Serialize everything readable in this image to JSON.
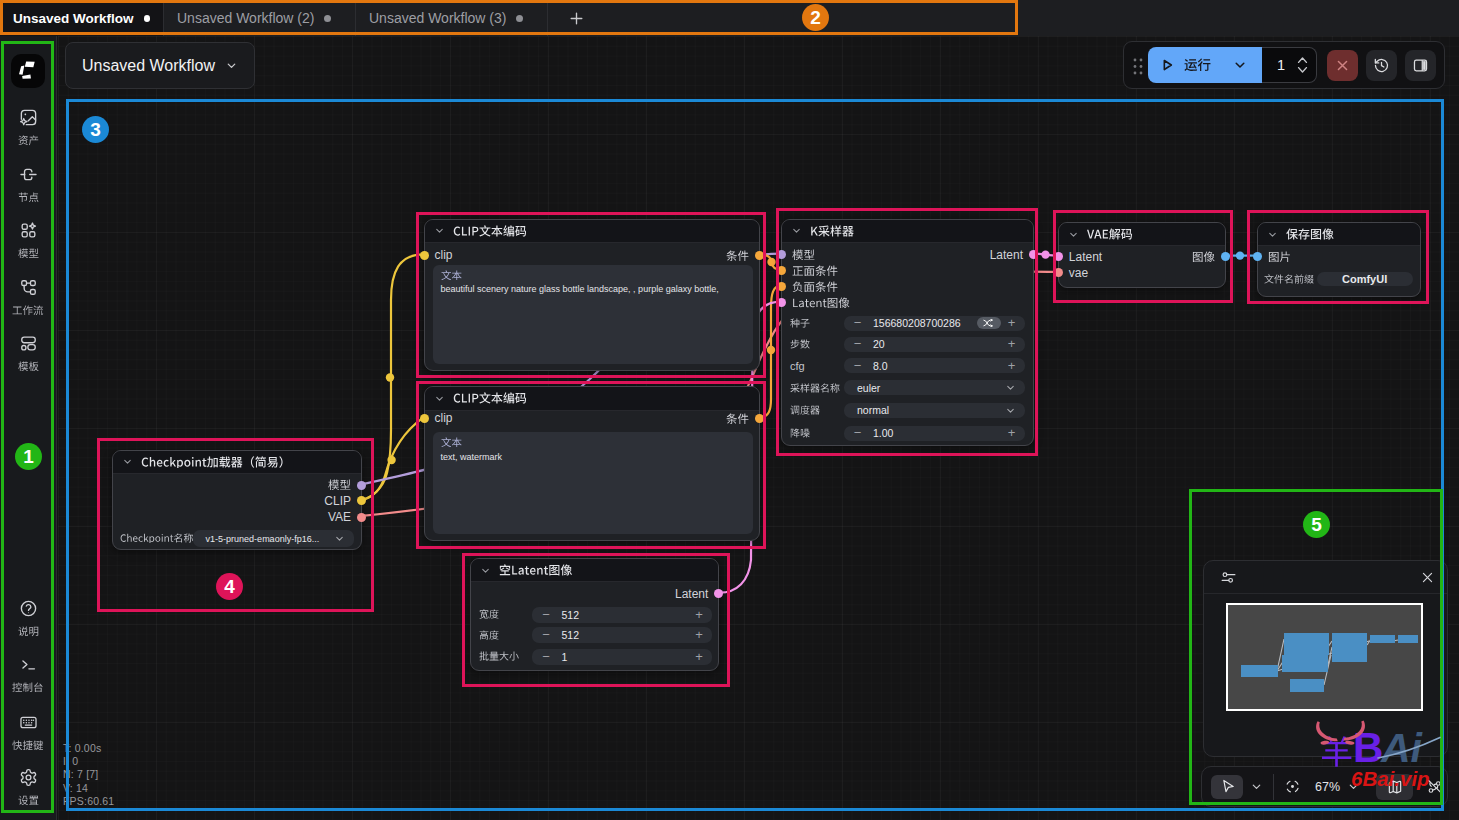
{
  "tabbar": {
    "tabs": [
      {
        "label": "Unsaved Workflow",
        "state": "active"
      },
      {
        "label": "Unsaved Workflow (2)",
        "state": "inactive"
      },
      {
        "label": "Unsaved Workflow (3)",
        "state": "inactive"
      }
    ]
  },
  "sidebar": {
    "top_items": [
      {
        "label": "资产",
        "icon": "assets-image-icon"
      },
      {
        "label": "节点",
        "icon": "nodes-icon"
      },
      {
        "label": "模型",
        "icon": "models-icon"
      },
      {
        "label": "工作流",
        "icon": "workflows-icon"
      },
      {
        "label": "模板",
        "icon": "templates-icon"
      }
    ],
    "bottom_items": [
      {
        "label": "说明",
        "icon": "help-icon"
      },
      {
        "label": "控制台",
        "icon": "terminal-icon"
      },
      {
        "label": "快捷键",
        "icon": "keyboard-icon"
      },
      {
        "label": "设置",
        "icon": "settings-gear-icon"
      }
    ]
  },
  "topbar": {
    "workflow_selector": {
      "label": "Unsaved Workflow"
    },
    "run_button": {
      "label": "运行"
    },
    "batch_count": "1"
  },
  "canvas_stats": {
    "lines": [
      "T: 0.00s",
      "I: 0",
      "N: 7 [7]",
      "V: 14",
      "FPS:60.61"
    ]
  },
  "nodes": {
    "checkpoint_loader": {
      "title": "Checkpoint加载器（简易）",
      "outputs": [
        "模型",
        "CLIP",
        "VAE"
      ],
      "widgets": {
        "ckpt_name": {
          "label": "Checkpoint名称",
          "value": "v1-5-pruned-emaonly-fp16..."
        }
      }
    },
    "clip_encode_positive": {
      "title": "CLIP文本编码",
      "inputs": [
        "clip"
      ],
      "outputs": [
        "条件"
      ],
      "widgets": {
        "text": {
          "label": "文本",
          "value": "beautiful scenery nature glass bottle landscape, , purple galaxy bottle,"
        }
      }
    },
    "clip_encode_negative": {
      "title": "CLIP文本编码",
      "inputs": [
        "clip"
      ],
      "outputs": [
        "条件"
      ],
      "widgets": {
        "text": {
          "label": "文本",
          "value": "text, watermark"
        }
      }
    },
    "ksampler": {
      "title": "K采样器",
      "inputs": [
        "模型",
        "正面条件",
        "负面条件",
        "Latent图像"
      ],
      "outputs": [
        "Latent"
      ],
      "widgets": {
        "seed": {
          "label": "种子",
          "value": "156680208700286"
        },
        "steps": {
          "label": "步数",
          "value": "20"
        },
        "cfg": {
          "label": "cfg",
          "value": "8.0"
        },
        "sampler_name": {
          "label": "采样器名称",
          "value": "euler"
        },
        "scheduler": {
          "label": "调度器",
          "value": "normal"
        },
        "denoise": {
          "label": "降噪",
          "value": "1.00"
        }
      }
    },
    "empty_latent": {
      "title": "空Latent图像",
      "outputs": [
        "Latent"
      ],
      "widgets": {
        "width": {
          "label": "宽度",
          "value": "512"
        },
        "height": {
          "label": "高度",
          "value": "512"
        },
        "batch_size": {
          "label": "批量大小",
          "value": "1"
        }
      }
    },
    "vae_decode": {
      "title": "VAE解码",
      "inputs": [
        "Latent",
        "vae"
      ],
      "outputs": [
        "图像"
      ]
    },
    "save_image": {
      "title": "保存图像",
      "inputs": [
        "图片"
      ],
      "widgets": {
        "filename_prefix": {
          "label": "文件名前缀",
          "value": "ComfyUI"
        }
      }
    }
  },
  "zoom_toolbar": {
    "zoom_level": "67%"
  },
  "watermark": {
    "logo_char": "羊",
    "logo_text_b": "B",
    "logo_text_ai": "Ai",
    "site": "6Bai.vip"
  },
  "annotations": {
    "badges": [
      "1",
      "2",
      "3",
      "4",
      "5"
    ],
    "colors": {
      "green": "#22b616",
      "orange": "#e2770f",
      "blue": "#1b89d6",
      "crimson": "#de1459"
    }
  },
  "colors": {
    "accent_run": "#62a7f9",
    "link_clip": "#edc63c",
    "link_conditioning": "#f5a73b",
    "link_model": "#b39ddb",
    "link_vae": "#f28b8b",
    "link_latent": "#f293e8",
    "link_image": "#5fb2f2"
  }
}
